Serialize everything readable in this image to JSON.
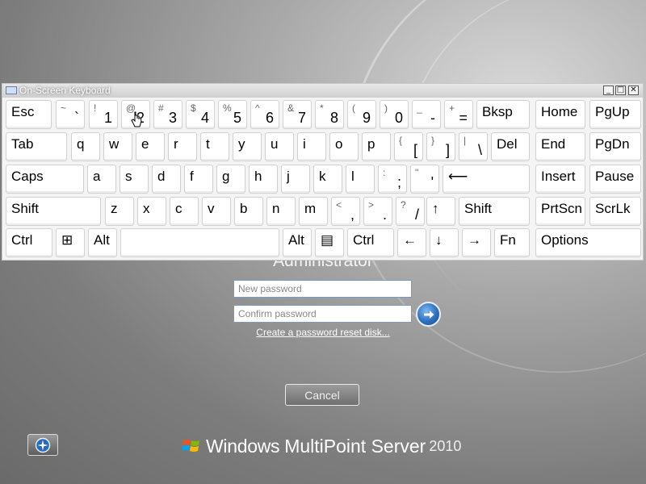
{
  "keyboard": {
    "title": "On-Screen Keyboard",
    "minimize_glyph": "_",
    "restore_glyph": "□",
    "close_glyph": "✕",
    "keys": [
      {
        "id": "esc",
        "label": "Esc"
      },
      {
        "id": "backtick",
        "top": "~",
        "bottom": "`"
      },
      {
        "id": "1",
        "top": "!",
        "bottom": "1"
      },
      {
        "id": "2",
        "top": "@",
        "bottom": "2"
      },
      {
        "id": "3",
        "top": "#",
        "bottom": "3"
      },
      {
        "id": "4",
        "top": "$",
        "bottom": "4"
      },
      {
        "id": "5",
        "top": "%",
        "bottom": "5"
      },
      {
        "id": "6",
        "top": "^",
        "bottom": "6"
      },
      {
        "id": "7",
        "top": "&",
        "bottom": "7"
      },
      {
        "id": "8",
        "top": "*",
        "bottom": "8"
      },
      {
        "id": "9",
        "top": "(",
        "bottom": "9"
      },
      {
        "id": "0",
        "top": ")",
        "bottom": "0"
      },
      {
        "id": "minus",
        "top": "_",
        "bottom": "-"
      },
      {
        "id": "equals",
        "top": "+",
        "bottom": "="
      },
      {
        "id": "bksp",
        "label": "Bksp"
      },
      {
        "id": "home",
        "label": "Home"
      },
      {
        "id": "pgup",
        "label": "PgUp"
      },
      {
        "id": "tab",
        "label": "Tab"
      },
      {
        "id": "q",
        "label": "q"
      },
      {
        "id": "w",
        "label": "w"
      },
      {
        "id": "e",
        "label": "e"
      },
      {
        "id": "r",
        "label": "r"
      },
      {
        "id": "t",
        "label": "t"
      },
      {
        "id": "y",
        "label": "y"
      },
      {
        "id": "u",
        "label": "u"
      },
      {
        "id": "i",
        "label": "i"
      },
      {
        "id": "o",
        "label": "o"
      },
      {
        "id": "p",
        "label": "p"
      },
      {
        "id": "lbracket",
        "top": "{",
        "bottom": "["
      },
      {
        "id": "rbracket",
        "top": "}",
        "bottom": "]"
      },
      {
        "id": "backslash",
        "top": "|",
        "bottom": "\\"
      },
      {
        "id": "del",
        "label": "Del"
      },
      {
        "id": "end",
        "label": "End"
      },
      {
        "id": "pgdn",
        "label": "PgDn"
      },
      {
        "id": "caps",
        "label": "Caps"
      },
      {
        "id": "a",
        "label": "a"
      },
      {
        "id": "s",
        "label": "s"
      },
      {
        "id": "d",
        "label": "d"
      },
      {
        "id": "f",
        "label": "f"
      },
      {
        "id": "g",
        "label": "g"
      },
      {
        "id": "h",
        "label": "h"
      },
      {
        "id": "j",
        "label": "j"
      },
      {
        "id": "k",
        "label": "k"
      },
      {
        "id": "l",
        "label": "l"
      },
      {
        "id": "semicolon",
        "top": ":",
        "bottom": ";"
      },
      {
        "id": "quote",
        "top": "\"",
        "bottom": "'"
      },
      {
        "id": "enter",
        "label": "⟵"
      },
      {
        "id": "insert",
        "label": "Insert"
      },
      {
        "id": "pause",
        "label": "Pause"
      },
      {
        "id": "lshift",
        "label": "Shift"
      },
      {
        "id": "z",
        "label": "z"
      },
      {
        "id": "x",
        "label": "x"
      },
      {
        "id": "c",
        "label": "c"
      },
      {
        "id": "v",
        "label": "v"
      },
      {
        "id": "b",
        "label": "b"
      },
      {
        "id": "n",
        "label": "n"
      },
      {
        "id": "m",
        "label": "m"
      },
      {
        "id": "comma",
        "top": "<",
        "bottom": ","
      },
      {
        "id": "period",
        "top": ">",
        "bottom": "."
      },
      {
        "id": "slash",
        "top": "?",
        "bottom": "/"
      },
      {
        "id": "up",
        "label": "↑"
      },
      {
        "id": "rshift",
        "label": "Shift"
      },
      {
        "id": "prtscn",
        "label": "PrtScn"
      },
      {
        "id": "scrlk",
        "label": "ScrLk"
      },
      {
        "id": "lctrl",
        "label": "Ctrl"
      },
      {
        "id": "win",
        "label": "⊞"
      },
      {
        "id": "lalt",
        "label": "Alt"
      },
      {
        "id": "space",
        "label": ""
      },
      {
        "id": "ralt",
        "label": "Alt"
      },
      {
        "id": "menu",
        "label": "▤"
      },
      {
        "id": "rctrl",
        "label": "Ctrl"
      },
      {
        "id": "left",
        "label": "←"
      },
      {
        "id": "down",
        "label": "↓"
      },
      {
        "id": "right",
        "label": "→"
      },
      {
        "id": "fn",
        "label": "Fn"
      },
      {
        "id": "options",
        "label": "Options"
      }
    ]
  },
  "logon": {
    "user_name": "Administrator",
    "new_password_placeholder": "New password",
    "confirm_password_placeholder": "Confirm password",
    "reset_link": "Create a password reset disk...",
    "cancel_label": "Cancel",
    "go_icon": "arrow-right-icon",
    "ease_of_access_icon": "ease-of-access-icon"
  },
  "branding": {
    "word1": "Windows",
    "word2": "MultiPoint Server",
    "word3": "2010"
  },
  "colors": {
    "accent_blue": "#2d6fc0",
    "keyboard_bg": "#f4f4f4",
    "key_bg": "#ffffff"
  }
}
